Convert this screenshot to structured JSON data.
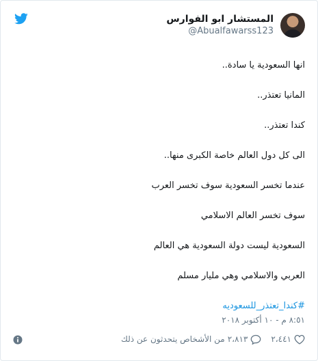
{
  "author": {
    "display_name": "المستشار ابو الفوارس",
    "handle": "@Abualfawarss123"
  },
  "tweet": {
    "lines": [
      "انها السعودية يا سادة..",
      "المانيا تعتذر..",
      "كندا تعتذر..",
      "الى كل دول العالم خاصة الكبرى منها..",
      "عندما تخسر السعودية سوف تخسر العرب",
      "سوف تخسر العالم الاسلامي",
      "السعودية ليست دولة السعودية هي العالم",
      "العربي والاسلامي وهي مليار مسلم"
    ],
    "hashtag": "#كندا_تعتذر_للسعوديه",
    "timestamp": "٨:٥١ م - ١٠ أكتوبر ٢٠١٨"
  },
  "actions": {
    "likes": "٢،٤٤١",
    "replies": "٢،٨١٣",
    "replies_label": "من الأشخاص يتحدثون عن ذلك"
  },
  "icons": {
    "brand": "twitter-bird-icon",
    "like": "heart-icon",
    "reply": "speech-bubble-icon",
    "info": "info-icon"
  },
  "colors": {
    "twitter_blue": "#1da1f2",
    "link": "#1b95e0",
    "muted": "#657786",
    "text": "#14171a"
  }
}
